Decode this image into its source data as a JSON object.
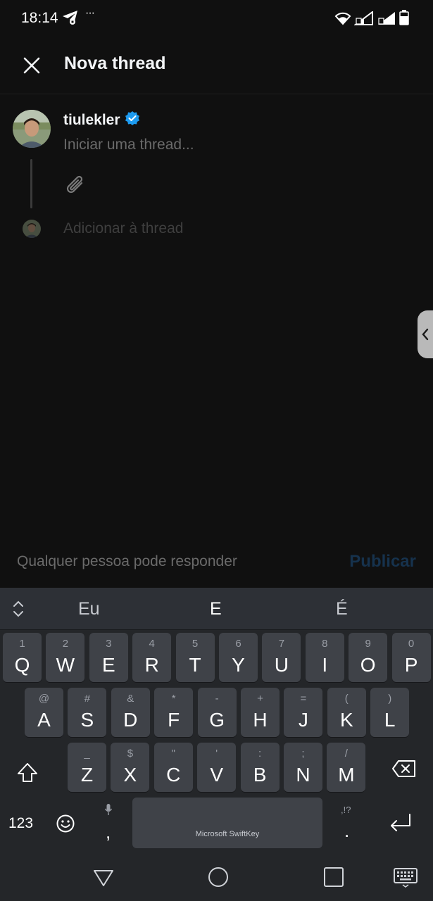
{
  "status_bar": {
    "time": "18:14",
    "notification_more": "···",
    "icons": [
      "telegram-icon",
      "wifi-icon",
      "signal-icon",
      "signal-icon",
      "battery-icon"
    ]
  },
  "header": {
    "title": "Nova thread"
  },
  "composer": {
    "username": "tiulekler",
    "verified": true,
    "input_placeholder": "Iniciar uma thread...",
    "input_value": "",
    "add_to_thread": "Adicionar à thread"
  },
  "footer": {
    "reply_scope": "Qualquer pessoa pode responder",
    "publish_label": "Publicar"
  },
  "keyboard": {
    "suggestions": [
      "Eu",
      "E",
      "É"
    ],
    "row1": [
      {
        "secondary": "1",
        "primary": "Q"
      },
      {
        "secondary": "2",
        "primary": "W"
      },
      {
        "secondary": "3",
        "primary": "E"
      },
      {
        "secondary": "4",
        "primary": "R"
      },
      {
        "secondary": "5",
        "primary": "T"
      },
      {
        "secondary": "6",
        "primary": "Y"
      },
      {
        "secondary": "7",
        "primary": "U"
      },
      {
        "secondary": "8",
        "primary": "I"
      },
      {
        "secondary": "9",
        "primary": "O"
      },
      {
        "secondary": "0",
        "primary": "P"
      }
    ],
    "row2": [
      {
        "secondary": "@",
        "primary": "A"
      },
      {
        "secondary": "#",
        "primary": "S"
      },
      {
        "secondary": "&",
        "primary": "D"
      },
      {
        "secondary": "*",
        "primary": "F"
      },
      {
        "secondary": "-",
        "primary": "G"
      },
      {
        "secondary": "+",
        "primary": "H"
      },
      {
        "secondary": "=",
        "primary": "J"
      },
      {
        "secondary": "(",
        "primary": "K"
      },
      {
        "secondary": ")",
        "primary": "L"
      }
    ],
    "row3": [
      {
        "secondary": "_",
        "primary": "Z"
      },
      {
        "secondary": "$",
        "primary": "X"
      },
      {
        "secondary": "\"",
        "primary": "C"
      },
      {
        "secondary": "'",
        "primary": "V"
      },
      {
        "secondary": ":",
        "primary": "B"
      },
      {
        "secondary": ";",
        "primary": "N"
      },
      {
        "secondary": "/",
        "primary": "M"
      }
    ],
    "numbers_label": "123",
    "comma": ",",
    "period": ".",
    "period_secondary": ",!?",
    "space_label": "Microsoft SwiftKey"
  },
  "colors": {
    "background": "#101010",
    "verified_badge": "#1d9bf0",
    "publish_disabled": "#16324d",
    "keyboard_bg": "#242629",
    "key_bg": "#3f4248"
  }
}
